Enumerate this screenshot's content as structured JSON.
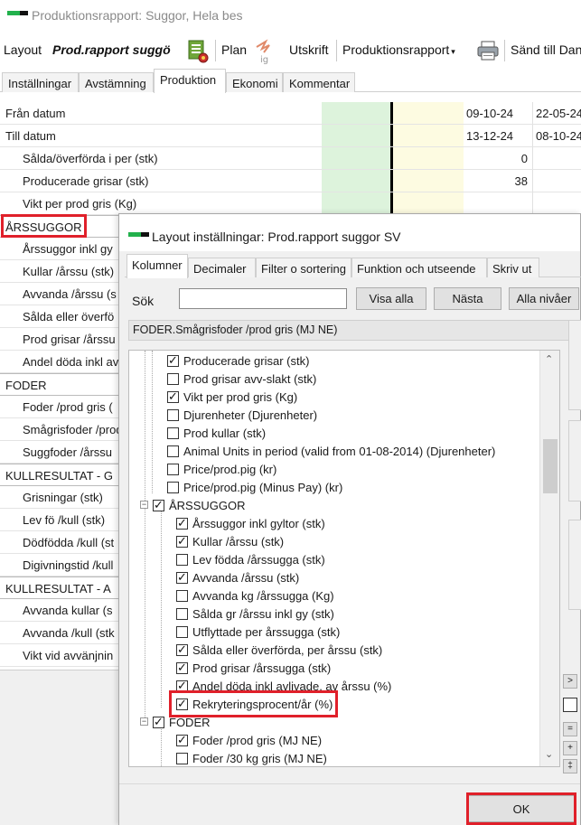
{
  "window": {
    "title": "Produktionsrapport: Suggor, Hela bes"
  },
  "toolbar": {
    "layout": "Layout",
    "layout_value": "Prod.rapport suggö",
    "plan": "Plan",
    "utskrift": "Utskrift",
    "report": "Produktionsrapport",
    "send": "Sänd till Dan",
    "dropdown_glyph": "▾"
  },
  "tabs": [
    "Inställningar",
    "Avstämning",
    "Produktion",
    "Ekonomi",
    "Kommentar"
  ],
  "grid": {
    "rows": [
      {
        "label": "Från datum",
        "v1": "09-10-24",
        "v2": "22-05-24"
      },
      {
        "label": "Till datum",
        "v1": "13-12-24",
        "v2": "08-10-24"
      },
      {
        "label": "Sålda/överförda i per (stk)",
        "v1": "0",
        "v2": ""
      },
      {
        "label": "Producerade grisar (stk)",
        "v1": "38",
        "v2": ""
      },
      {
        "label": "Vikt per prod gris (Kg)",
        "v1": "",
        "v2": ""
      },
      {
        "label": "ÅRSSUGGOR",
        "v1": "",
        "v2": ""
      },
      {
        "label": "Årssuggor inkl gy",
        "v1": "",
        "v2": ""
      },
      {
        "label": "Kullar /årssu (stk)",
        "v1": "",
        "v2": ""
      },
      {
        "label": "Avvanda /årssu (s",
        "v1": "",
        "v2": ""
      },
      {
        "label": "Sålda eller överfö",
        "v1": "",
        "v2": ""
      },
      {
        "label": "Prod grisar /årssu",
        "v1": "",
        "v2": ""
      },
      {
        "label": "Andel döda inkl av",
        "v1": "",
        "v2": ""
      },
      {
        "label": "FODER",
        "v1": "",
        "v2": ""
      },
      {
        "label": "Foder /prod gris (",
        "v1": "",
        "v2": ""
      },
      {
        "label": "Smågrisfoder /prod",
        "v1": "",
        "v2": ""
      },
      {
        "label": "Suggfoder /årssu",
        "v1": "",
        "v2": ""
      },
      {
        "label": "KULLRESULTAT - G",
        "v1": "",
        "v2": ""
      },
      {
        "label": "Grisningar (stk)",
        "v1": "",
        "v2": ""
      },
      {
        "label": "Lev fö /kull (stk)",
        "v1": "",
        "v2": ""
      },
      {
        "label": "Dödfödda /kull (st",
        "v1": "",
        "v2": ""
      },
      {
        "label": "Digivningstid /kull",
        "v1": "",
        "v2": ""
      },
      {
        "label": "KULLRESULTAT - A",
        "v1": "",
        "v2": ""
      },
      {
        "label": "Avvanda kullar (s",
        "v1": "",
        "v2": ""
      },
      {
        "label": "Avvanda /kull (stk",
        "v1": "",
        "v2": ""
      },
      {
        "label": "Vikt vid avvänjnin",
        "v1": "",
        "v2": ""
      }
    ]
  },
  "dialog": {
    "title": "Layout inställningar: Prod.rapport suggor SV",
    "tabs": [
      "Kolumner",
      "Decimaler",
      "Filter o sortering",
      "Funktion och utseende",
      "Skriv ut"
    ],
    "search_label": "Sök",
    "search_value": "",
    "btn_show_all": "Visa alla",
    "btn_next": "Nästa",
    "btn_levels": "Alla nivåer",
    "path": "FODER.Smågrisfoder /prod gris (MJ NE)",
    "tree": [
      {
        "label": "Producerade grisar (stk)",
        "checked": true
      },
      {
        "label": "Prod grisar avv-slakt (stk)",
        "checked": false
      },
      {
        "label": "Vikt per prod gris (Kg)",
        "checked": true
      },
      {
        "label": "Djurenheter (Djurenheter)",
        "checked": false
      },
      {
        "label": "Prod kullar (stk)",
        "checked": false
      },
      {
        "label": "Animal Units in period (valid from 01-08-2014) (Djurenheter)",
        "checked": false
      },
      {
        "label": "Price/prod.pig (kr)",
        "checked": false
      },
      {
        "label": "Price/prod.pig (Minus Pay) (kr)",
        "checked": false
      },
      {
        "label": "ÅRSSUGGOR",
        "checked": true
      },
      {
        "label": "Årssuggor inkl gyltor (stk)",
        "checked": true
      },
      {
        "label": "Kullar /årssu (stk)",
        "checked": true
      },
      {
        "label": "Lev födda /årssugga (stk)",
        "checked": false
      },
      {
        "label": "Avvanda /årssu (stk)",
        "checked": true
      },
      {
        "label": "Avvanda kg /årssugga (Kg)",
        "checked": false
      },
      {
        "label": "Sålda gr /årssu inkl gy (stk)",
        "checked": false
      },
      {
        "label": "Utflyttade per årssugga (stk)",
        "checked": false
      },
      {
        "label": "Sålda eller överförda, per årssu (stk)",
        "checked": true
      },
      {
        "label": "Prod grisar /årssugga (stk)",
        "checked": true
      },
      {
        "label": "Andel döda inkl avlivade, av årssu (%)",
        "checked": true
      },
      {
        "label": "Rekryteringsprocent/år (%)",
        "checked": true
      },
      {
        "label": "FODER",
        "checked": true
      },
      {
        "label": "Foder /prod gris (MJ NE)",
        "checked": true
      },
      {
        "label": "Foder /30 kg gris (MJ NE)",
        "checked": false
      }
    ],
    "side_buttons": [
      ">",
      "=",
      "+",
      "‡"
    ],
    "ok_label": "OK"
  }
}
